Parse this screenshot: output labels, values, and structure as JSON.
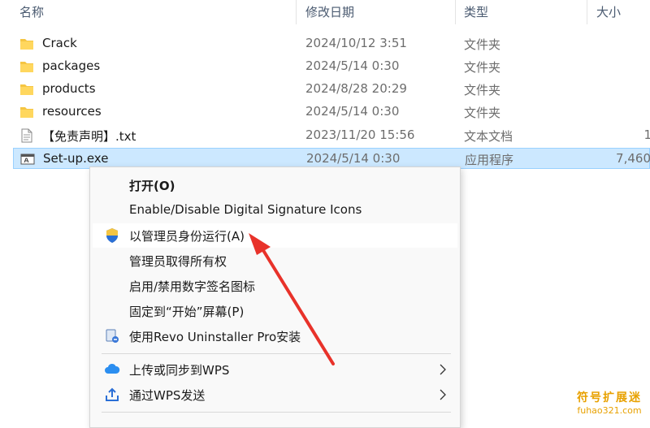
{
  "columns": {
    "name": "名称",
    "date": "修改日期",
    "type": "类型",
    "size": "大小"
  },
  "files": [
    {
      "icon": "folder-icon",
      "name": "Crack",
      "date": "2024/10/12 3:51",
      "type": "文件夹",
      "size": ""
    },
    {
      "icon": "folder-icon",
      "name": "packages",
      "date": "2024/5/14 0:30",
      "type": "文件夹",
      "size": ""
    },
    {
      "icon": "folder-icon",
      "name": "products",
      "date": "2024/8/28 20:29",
      "type": "文件夹",
      "size": ""
    },
    {
      "icon": "folder-icon",
      "name": "resources",
      "date": "2024/5/14 0:30",
      "type": "文件夹",
      "size": ""
    },
    {
      "icon": "text-file-icon",
      "name": "【免责声明】.txt",
      "date": "2023/11/20 15:56",
      "type": "文本文档",
      "size": "1"
    },
    {
      "icon": "exe-file-icon",
      "name": "Set-up.exe",
      "date": "2024/5/14 0:30",
      "type": "应用程序",
      "size": "7,460",
      "selected": true
    }
  ],
  "context_menu": {
    "items": [
      {
        "label": "打开(O)",
        "bold": true
      },
      {
        "label": "Enable/Disable Digital Signature Icons"
      },
      {
        "label": "以管理员身份运行(A)",
        "icon": "uac-shield-icon",
        "hover": true
      },
      {
        "label": "管理员取得所有权"
      },
      {
        "label": "启用/禁用数字签名图标"
      },
      {
        "label": "固定到“开始”屏幕(P)"
      },
      {
        "label": "使用Revo Uninstaller Pro安装",
        "icon": "revo-uninstaller-icon"
      },
      {
        "label": "上传或同步到WPS",
        "icon": "wps-cloud-icon",
        "submenu": true
      },
      {
        "label": "通过WPS发送",
        "icon": "wps-share-icon",
        "submenu": true
      }
    ]
  },
  "watermark": {
    "line1": "符号扩展迷",
    "line2": "fuhao321.com"
  },
  "colors": {
    "selection_bg": "#cce8ff",
    "selection_border": "#99d1ff",
    "folder": "#f5c542",
    "arrow": "#e8322a",
    "watermark": "#e8a100"
  }
}
